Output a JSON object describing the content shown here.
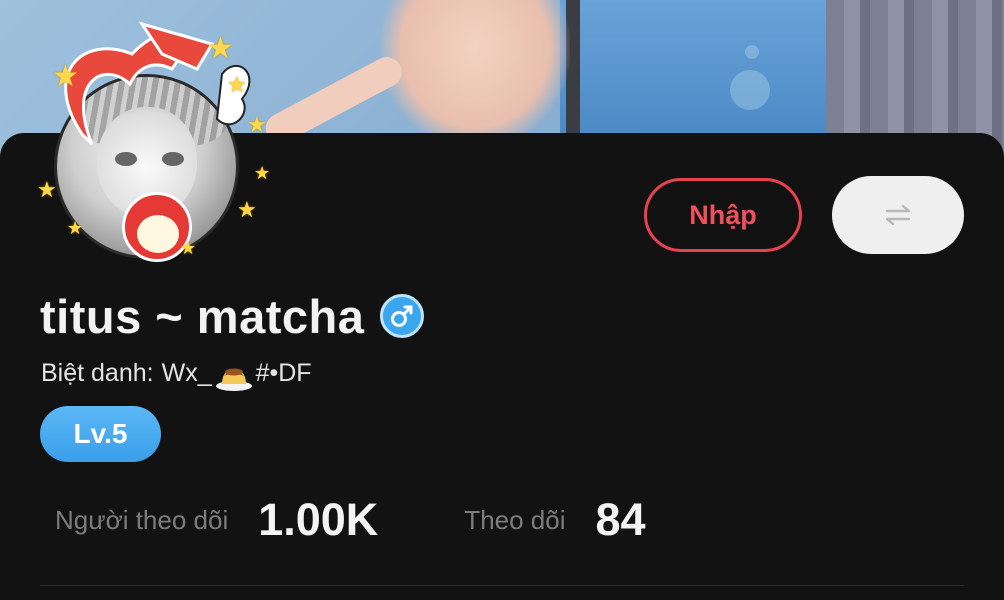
{
  "profile": {
    "username": "titus ~ matcha",
    "nickname_label": "Biệt danh:",
    "nickname_prefix": "Wx_",
    "nickname_suffix": "#•DF",
    "level": "Lv.5",
    "gender": "male"
  },
  "actions": {
    "primary_label": "Nhập",
    "switch_icon": "swap-arrows-icon"
  },
  "stats": {
    "followers_label": "Người theo dõi",
    "followers_value": "1.00K",
    "following_label": "Theo dõi",
    "following_value": "84"
  },
  "colors": {
    "accent_red": "#e8424f",
    "level_blue": "#3a9ee9",
    "gender_blue": "#3aa6ef",
    "background": "#121212"
  }
}
